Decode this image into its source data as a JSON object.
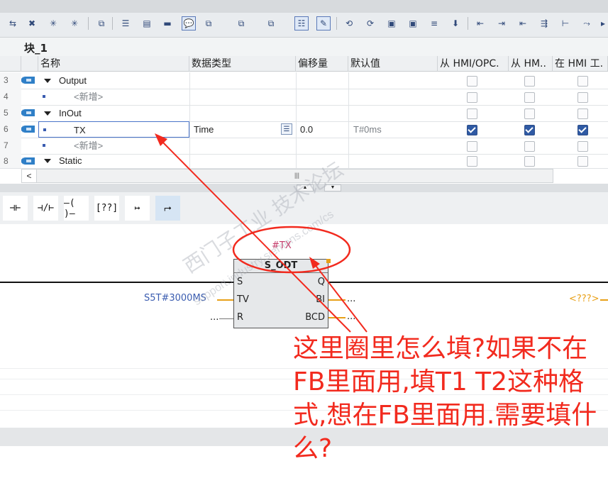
{
  "toolbar": {
    "icons": [
      "block-insert-icon",
      "delete-icon",
      "add-network-icon",
      "add-network2-icon",
      "go-to-icon",
      "align-left-icon",
      "collapse-icon",
      "expand-icon",
      "comment-icon",
      "insert-tag-icon",
      "insert-tag2-icon",
      "insert-tag3-icon",
      "list-icon",
      "wizard-icon",
      "call-icon",
      "call2-icon",
      "monitor-icon",
      "monitor2-icon",
      "indent-icon",
      "download-icon",
      "fb-call-icon",
      "step-in-icon",
      "step-out-icon",
      "jump-icon",
      "branch-icon",
      "branch2-icon",
      "more-icon"
    ]
  },
  "block": {
    "title": "块_1"
  },
  "grid": {
    "headers": {
      "name": "名称",
      "type": "数据类型",
      "offset": "偏移量",
      "default": "默认值",
      "hmi_opc": "从 HMI/OPC.",
      "hmi2": "从 HM..",
      "hmi3": "在 HMI 工."
    },
    "rows": [
      {
        "num": "3",
        "name": "Output",
        "kind": "section",
        "type": "",
        "offset": "",
        "default": "",
        "checks": [
          false,
          false,
          false
        ]
      },
      {
        "num": "4",
        "name": "<新增>",
        "kind": "add",
        "type": "",
        "offset": "",
        "default": "",
        "checks": [
          false,
          false,
          false
        ]
      },
      {
        "num": "5",
        "name": "InOut",
        "kind": "section",
        "type": "",
        "offset": "",
        "default": "",
        "checks": [
          false,
          false,
          false
        ]
      },
      {
        "num": "6",
        "name": "TX",
        "kind": "var",
        "type": "Time",
        "offset": "0.0",
        "default": "T#0ms",
        "checks": [
          true,
          true,
          true
        ]
      },
      {
        "num": "7",
        "name": "<新增>",
        "kind": "add",
        "type": "",
        "offset": "",
        "default": "",
        "checks": [
          false,
          false,
          false
        ]
      },
      {
        "num": "8",
        "name": "Static",
        "kind": "section",
        "type": "",
        "offset": "",
        "default": "",
        "checks": [
          false,
          false,
          false
        ]
      }
    ],
    "scroll_left": "<",
    "scroll_thumb": "|||"
  },
  "ladder": {
    "buttons": [
      "⊣⊢",
      "⊣/⊢",
      "–( )–",
      "[??]",
      "↦",
      "⮣"
    ],
    "button_names": [
      "no-contact-icon",
      "nc-contact-icon",
      "coil-icon",
      "empty-box-icon",
      "open-branch-icon",
      "close-branch-icon"
    ]
  },
  "network": {
    "instance": "#TX",
    "block_name": "S_ODT",
    "pin_s": "S",
    "pin_tv": "TV",
    "pin_r": "R",
    "pin_q": "Q",
    "pin_bi": "BI",
    "pin_bcd": "BCD",
    "tv_value": "S5T#3000MS",
    "r_value": "...",
    "bi_value": "...",
    "bcd_value": "...",
    "out_value": "<???>"
  },
  "annotation": {
    "text": "这里圈里怎么填?如果不在FB里面用,填T1 T2这种格式,想在FB里面用.需要填什么?",
    "color": "#f22a1e"
  },
  "watermark": {
    "line1": "西门子工业 技术论坛",
    "line2": "support.industry.siemens.com/cs"
  }
}
